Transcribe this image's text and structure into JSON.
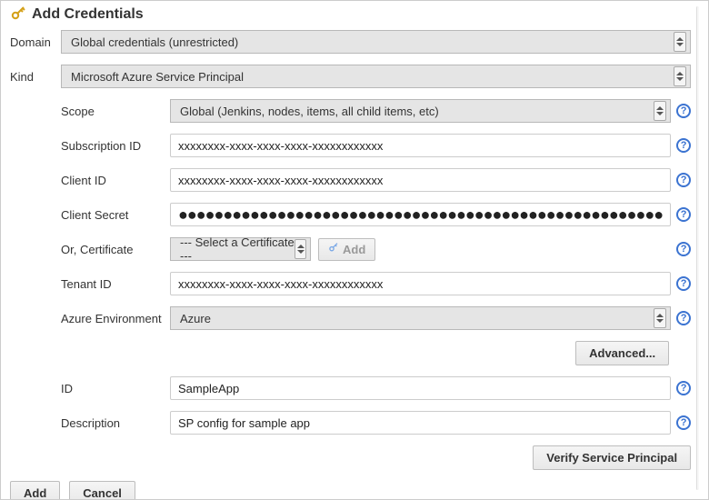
{
  "title": "Add Credentials",
  "labels": {
    "domain": "Domain",
    "kind": "Kind",
    "scope": "Scope",
    "subscription_id": "Subscription ID",
    "client_id": "Client ID",
    "client_secret": "Client Secret",
    "or_certificate": "Or, Certificate",
    "tenant_id": "Tenant ID",
    "azure_env": "Azure Environment",
    "id": "ID",
    "description": "Description"
  },
  "values": {
    "domain": "Global credentials (unrestricted)",
    "kind": "Microsoft Azure Service Principal",
    "scope": "Global (Jenkins, nodes, items, all child items, etc)",
    "subscription_id": "xxxxxxxx-xxxx-xxxx-xxxx-xxxxxxxxxxxx",
    "client_id": "xxxxxxxx-xxxx-xxxx-xxxx-xxxxxxxxxxxx",
    "client_secret_mask": "●●●●●●●●●●●●●●●●●●●●●●●●●●●●●●●●●●●●●●●●●●●●●●●●●●●●●●",
    "certificate": "--- Select a Certificate ---",
    "tenant_id": "xxxxxxxx-xxxx-xxxx-xxxx-xxxxxxxxxxxx",
    "azure_env": "Azure",
    "id": "SampleApp",
    "description": "SP config for sample app"
  },
  "buttons": {
    "cert_add": "Add",
    "advanced": "Advanced...",
    "verify": "Verify Service Principal",
    "add": "Add",
    "cancel": "Cancel"
  },
  "help_glyph": "?"
}
